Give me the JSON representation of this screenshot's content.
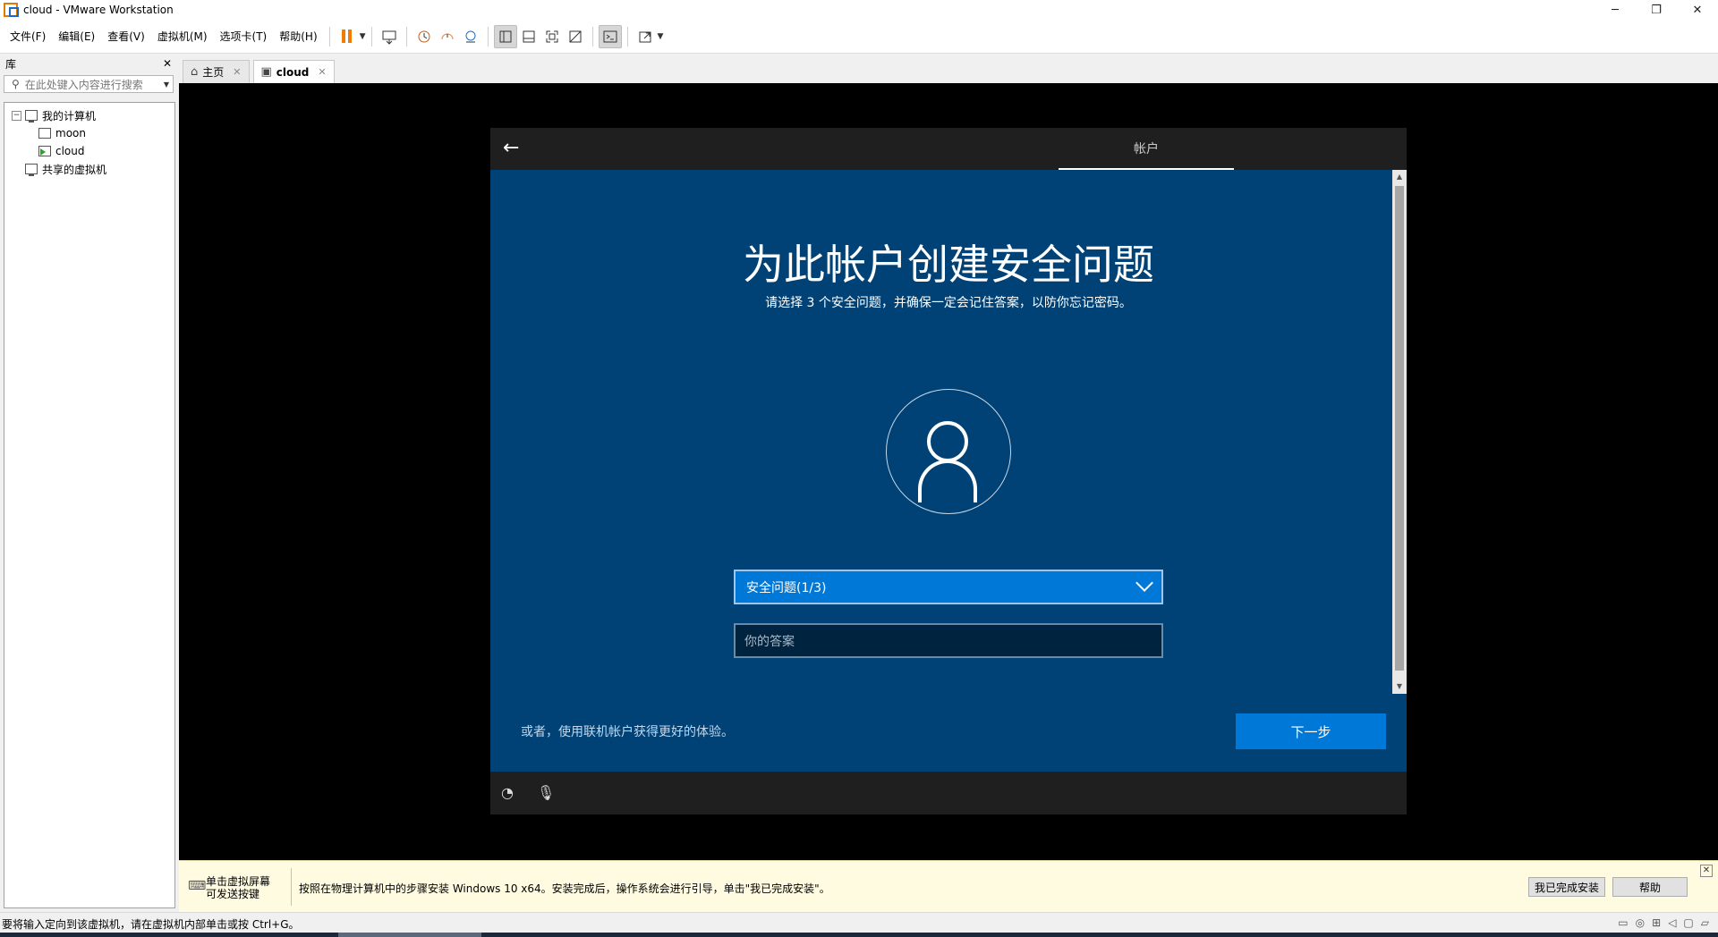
{
  "window": {
    "title": "cloud - VMware Workstation",
    "controls": {
      "minimize": "─",
      "maximize": "❐",
      "close": "✕"
    }
  },
  "menu": [
    "文件(F)",
    "编辑(E)",
    "查看(V)",
    "虚拟机(M)",
    "选项卡(T)",
    "帮助(H)"
  ],
  "library": {
    "title": "库",
    "close": "✕",
    "search_placeholder": "在此处键入内容进行搜索",
    "tree": {
      "root": "我的计算机",
      "vms": [
        "moon",
        "cloud"
      ],
      "shared": "共享的虚拟机"
    }
  },
  "tabs": [
    {
      "label": "主页",
      "icon": "home-icon"
    },
    {
      "label": "cloud",
      "icon": "vm-running-icon"
    }
  ],
  "guest": {
    "header_tab": "帐户",
    "title": "为此帐户创建安全问题",
    "subtitle": "请选择 3 个安全问题，并确保一定会记住答案，以防你忘记密码。",
    "question_select": "安全问题(1/3)",
    "answer_placeholder": "你的答案",
    "online_link": "或者，使用联机帐户获得更好的体验。",
    "next_button": "下一步"
  },
  "hintbar": {
    "left_line1": "单击虚拟屏幕",
    "left_line2": "可发送按键",
    "message": "按照在物理计算机中的步骤安装 Windows 10 x64。安装完成后，操作系统会进行引导，单击\"我已完成安装\"。",
    "done_button": "我已完成安装",
    "help_button": "帮助"
  },
  "status": {
    "text": "要将输入定向到该虚拟机，请在虚拟机内部单击或按 Ctrl+G。"
  },
  "colors": {
    "oobe_bg": "#004275",
    "accent": "#0078d7",
    "pause_accent": "#f07d00"
  }
}
